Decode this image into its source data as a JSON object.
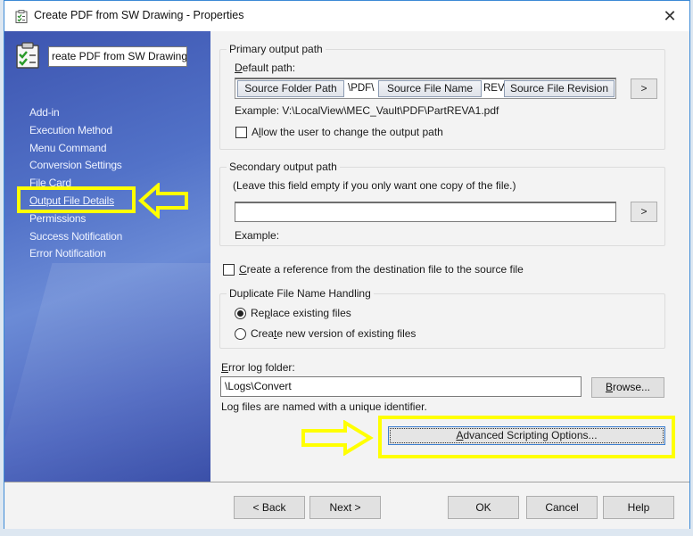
{
  "window": {
    "title": "Create PDF from SW Drawing - Properties",
    "close_label": "✕"
  },
  "sidebar": {
    "name_value": "reate PDF from SW Drawing",
    "items": [
      {
        "label": "Add-in"
      },
      {
        "label": "Execution Method"
      },
      {
        "label": "Menu Command"
      },
      {
        "label": "Conversion Settings"
      },
      {
        "label": "File Card"
      },
      {
        "label": "Output File Details",
        "active": true
      },
      {
        "label": "Permissions"
      },
      {
        "label": "Success Notification"
      },
      {
        "label": "Error Notification"
      }
    ]
  },
  "primary": {
    "legend": "Primary output path",
    "default_path_label_u": "D",
    "default_path_label_rest": "efault path:",
    "tokens": {
      "source_folder_path": "Source Folder Path",
      "sep1": "\\PDF\\",
      "source_file_name": "Source File Name",
      "sep2": "REV",
      "source_file_revision": "Source File Revision"
    },
    "more_button": ">",
    "example": "Example: V:\\LocalView\\MEC_Vault\\PDF\\PartREVA1.pdf",
    "allow_change_label_pre": "A",
    "allow_change_label_u": "l",
    "allow_change_label_rest": "low the user to change the output path",
    "allow_change_checked": false
  },
  "secondary": {
    "legend": "Secondary output path",
    "hint": "(Leave this field empty if you only want one copy of the file.)",
    "value": "",
    "more_button": ">",
    "example": "Example:"
  },
  "reference": {
    "label_u": "C",
    "label_rest": "reate a reference from the destination file to the source file",
    "checked": false
  },
  "duplicate": {
    "legend": "Duplicate File Name Handling",
    "options": [
      {
        "pre": "Re",
        "u": "p",
        "rest": "lace existing files",
        "selected": true
      },
      {
        "pre": "Crea",
        "u": "t",
        "rest": "e new version of existing files",
        "selected": false
      }
    ]
  },
  "error_log": {
    "label_u": "E",
    "label_rest": "rror log folder:",
    "value": "\\Logs\\Convert",
    "browse_u": "B",
    "browse_rest": "rowse...",
    "note": "Log files are named with a unique identifier."
  },
  "advanced": {
    "label_u": "A",
    "label_rest": "dvanced Scripting Options..."
  },
  "footer": {
    "back": "< Back",
    "next": "Next >",
    "ok": "OK",
    "cancel": "Cancel",
    "help": "Help"
  },
  "annotations": {
    "highlight_color": "#ffff00"
  }
}
